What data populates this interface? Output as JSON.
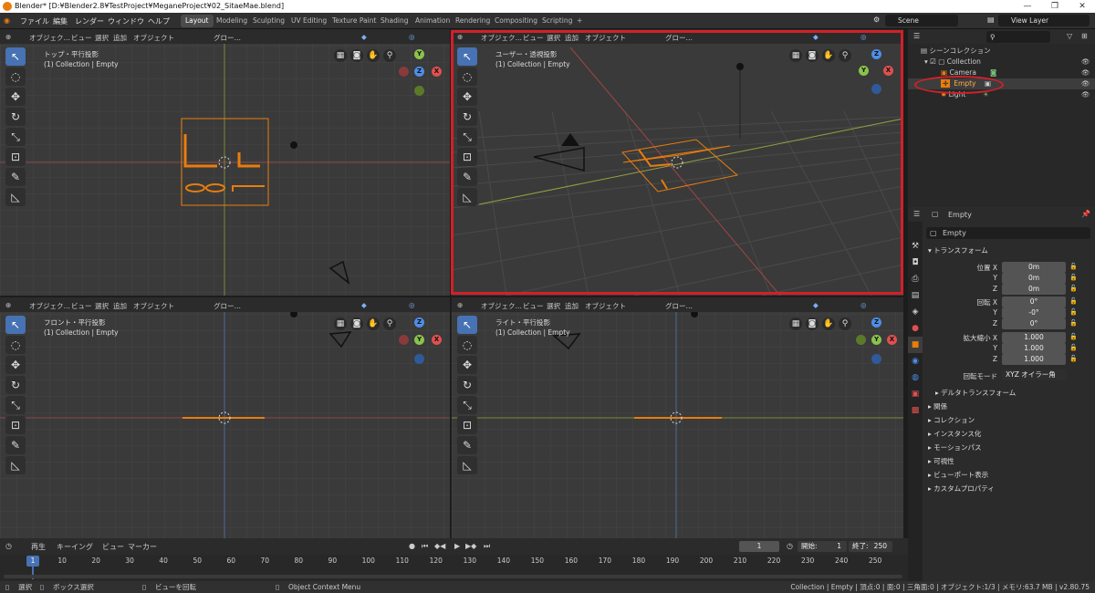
{
  "window": {
    "title": "Blender* [D:¥Blender2.8¥TestProject¥MeganeProject¥02_SitaeMae.blend]"
  },
  "menu": [
    "ファイル",
    "編集",
    "レンダー",
    "ウィンドウ",
    "ヘルプ"
  ],
  "workspaces": [
    "Layout",
    "Modeling",
    "Sculpting",
    "UV Editing",
    "Texture Paint",
    "Shading",
    "Animation",
    "Rendering",
    "Compositing",
    "Scripting",
    "+"
  ],
  "scene": "Scene",
  "view_layer": "View Layer",
  "viewport_header": {
    "mode": "オブジェク…",
    "view": "ビュー",
    "select": "選択",
    "add": "追加",
    "object": "オブジェクト",
    "orient": "グロー…"
  },
  "viewports": {
    "top": {
      "title": "トップ・平行投影",
      "sub": "(1) Collection | Empty"
    },
    "user": {
      "title": "ユーザー・透視投影",
      "sub": "(1) Collection | Empty"
    },
    "front": {
      "title": "フロント・平行投影",
      "sub": "(1) Collection | Empty"
    },
    "right": {
      "title": "ライト・平行投影",
      "sub": "(1) Collection | Empty"
    }
  },
  "gizmo": {
    "x": "X",
    "y": "Y",
    "z": "Z"
  },
  "outliner": {
    "scene_collection": "シーンコレクション",
    "collection": "Collection",
    "items": [
      "Camera",
      "Empty",
      "Light"
    ]
  },
  "properties": {
    "object_name_tab": "Empty",
    "object_name": "Empty",
    "transform": "トランスフォーム",
    "location_label": "位置 X",
    "y": "Y",
    "z": "Z",
    "loc": [
      "0m",
      "0m",
      "0m"
    ],
    "rotation_label": "回転 X",
    "rot": [
      "0°",
      "-0°",
      "0°"
    ],
    "scale_label": "拡大縮小 X",
    "scale": [
      "1.000",
      "1.000",
      "1.000"
    ],
    "rotmode_label": "回転モード",
    "rotmode": "XYZ オイラー角",
    "delta": "デルタトランスフォーム",
    "sections": [
      "関係",
      "コレクション",
      "インスタンス化",
      "モーションパス",
      "可視性",
      "ビューポート表示",
      "カスタムプロパティ"
    ]
  },
  "timeline": {
    "menus": [
      "再生",
      "キーイング",
      "ビュー",
      "マーカー"
    ],
    "current": "1",
    "start_label": "開始:",
    "start": "1",
    "end_label": "終了:",
    "end": "250",
    "ticks": [
      "1",
      "10",
      "20",
      "30",
      "40",
      "50",
      "60",
      "70",
      "80",
      "90",
      "100",
      "110",
      "120",
      "130",
      "140",
      "150",
      "160",
      "170",
      "180",
      "190",
      "200",
      "210",
      "220",
      "230",
      "240",
      "250"
    ]
  },
  "status": {
    "select": "選択",
    "box": "ボックス選択",
    "rotate": "ビューを回転",
    "context": "Object Context Menu",
    "info": "Collection | Empty | 頂点:0 | 面:0 | 三角面:0 | オブジェクト:1/3 | メモリ:63.7 MB | v2.80.75"
  },
  "colors": {
    "accent": "#4772b3",
    "highlight": "#d2202a",
    "selected": "#e87d0d"
  }
}
